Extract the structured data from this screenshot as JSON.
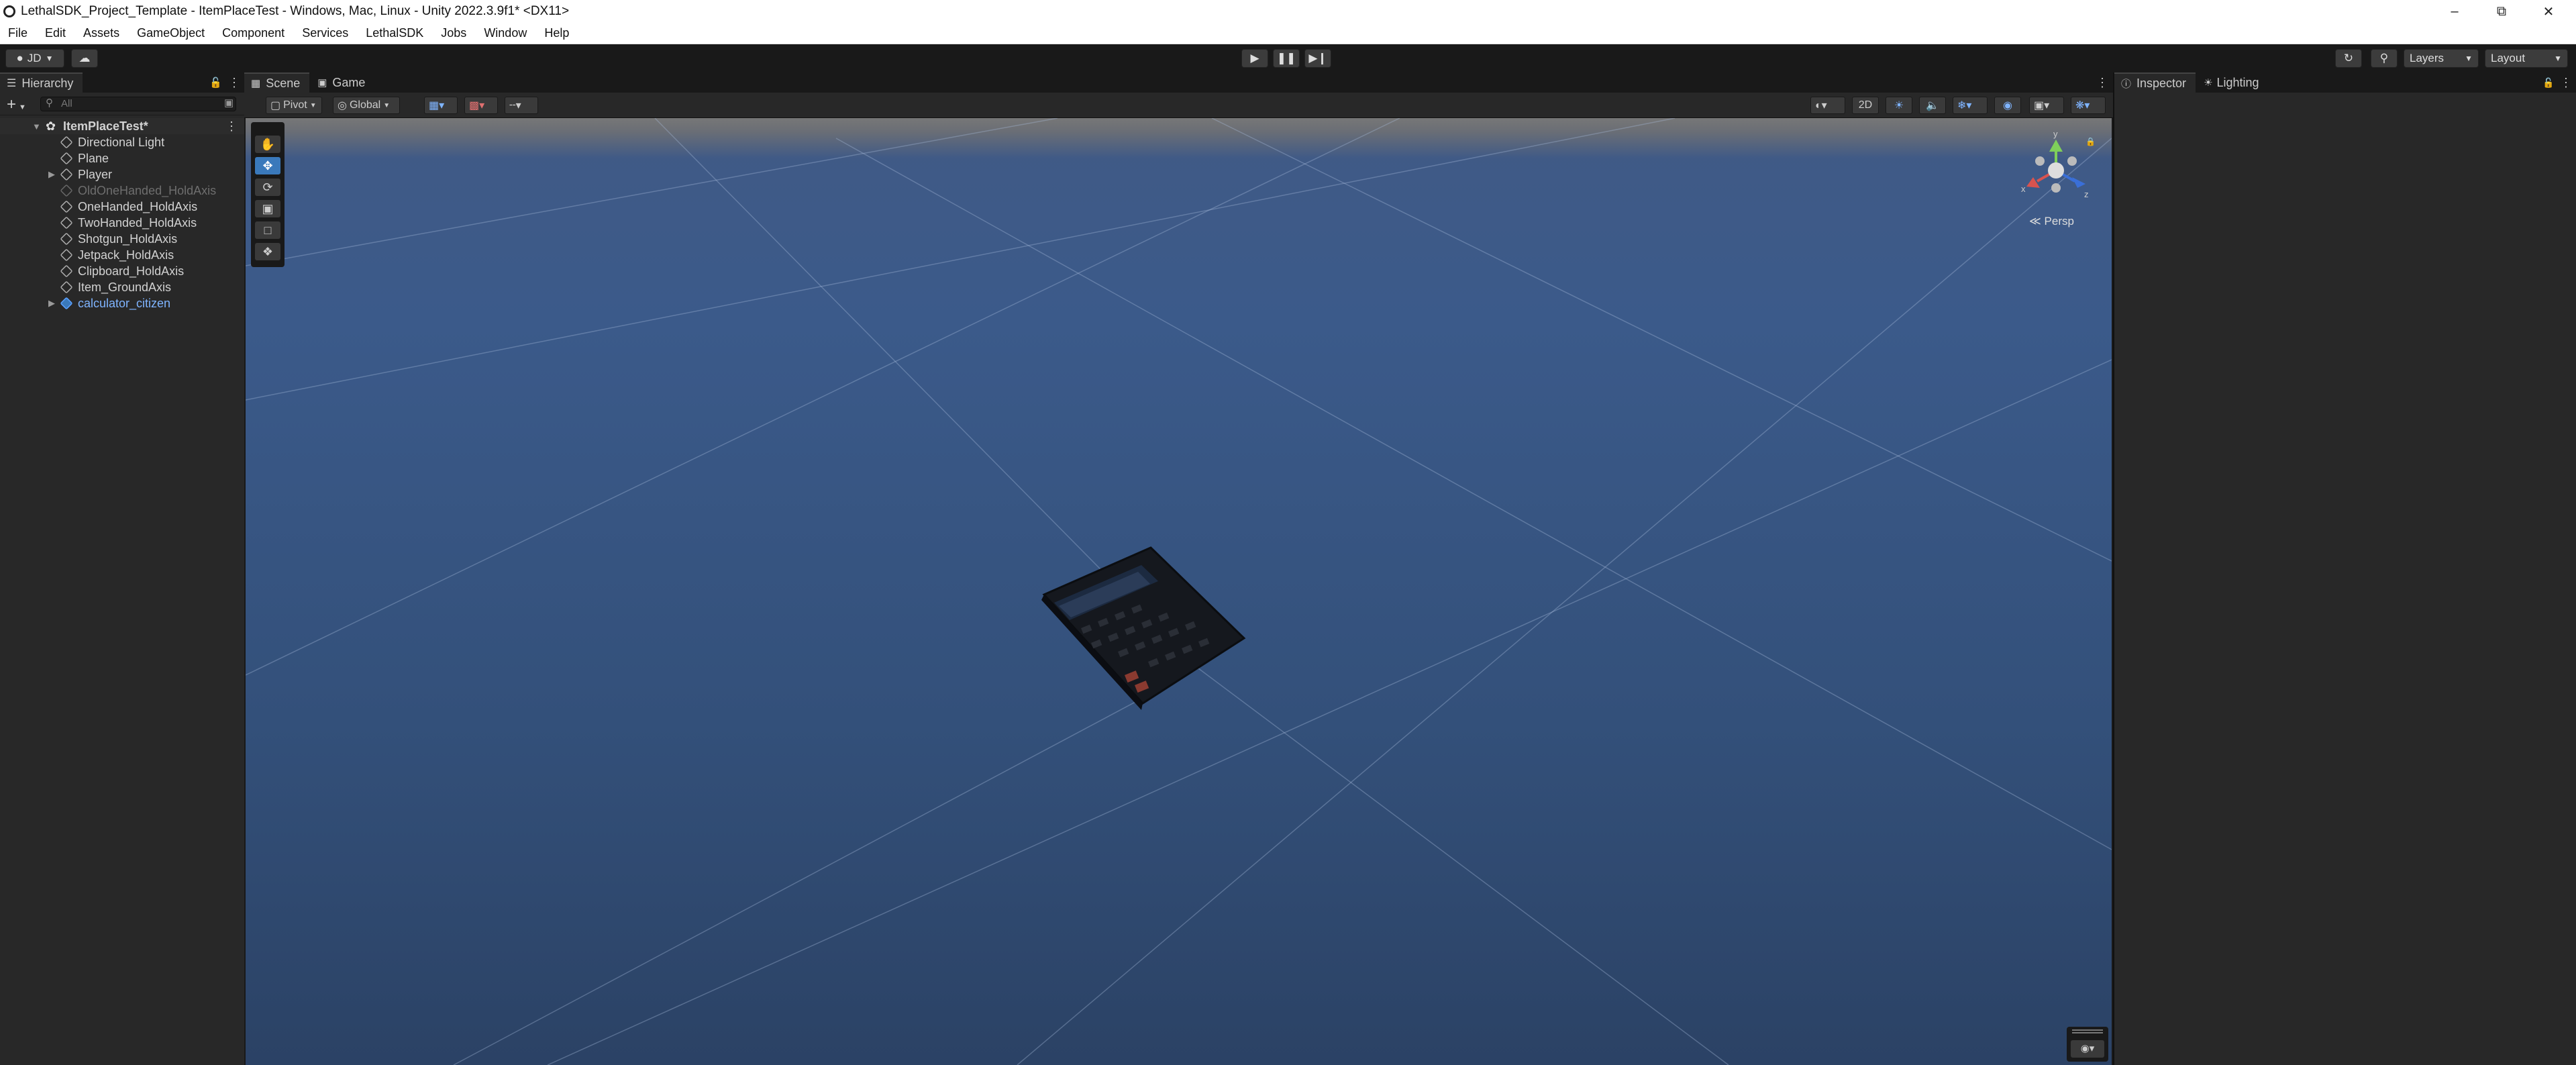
{
  "window": {
    "title": "LethalSDK_Project_Template - ItemPlaceTest - Windows, Mac, Linux - Unity 2022.3.9f1* <DX11>"
  },
  "menubar": {
    "items": [
      "File",
      "Edit",
      "Assets",
      "GameObject",
      "Component",
      "Services",
      "LethalSDK",
      "Jobs",
      "Window",
      "Help"
    ]
  },
  "toolbar": {
    "account_label": "JD",
    "layers_label": "Layers",
    "layout_label": "Layout"
  },
  "hierarchy": {
    "tab_label": "Hierarchy",
    "search_placeholder": "All",
    "scene_name": "ItemPlaceTest*",
    "items": [
      {
        "label": "Directional Light",
        "state": "normal"
      },
      {
        "label": "Plane",
        "state": "normal"
      },
      {
        "label": "Player",
        "state": "normal"
      },
      {
        "label": "OldOneHanded_HoldAxis",
        "state": "disabled"
      },
      {
        "label": "OneHanded_HoldAxis",
        "state": "normal"
      },
      {
        "label": "TwoHanded_HoldAxis",
        "state": "normal"
      },
      {
        "label": "Shotgun_HoldAxis",
        "state": "normal"
      },
      {
        "label": "Jetpack_HoldAxis",
        "state": "normal"
      },
      {
        "label": "Clipboard_HoldAxis",
        "state": "normal"
      },
      {
        "label": "Item_GroundAxis",
        "state": "normal"
      },
      {
        "label": "calculator_citizen",
        "state": "prefab"
      }
    ]
  },
  "scene_view": {
    "tabs": [
      "Scene",
      "Game"
    ],
    "pivot_label": "Pivot",
    "global_label": "Global",
    "mode_2d_label": "2D",
    "projection_label": "Persp",
    "gizmo_axes": {
      "x": "x",
      "y": "y",
      "z": "z"
    }
  },
  "right_panel": {
    "tabs": [
      "Inspector",
      "Lighting"
    ]
  },
  "colors": {
    "accent": "#3a79bb",
    "prefab_text": "#7fb4ff",
    "disabled_text": "#6e6e6e"
  }
}
